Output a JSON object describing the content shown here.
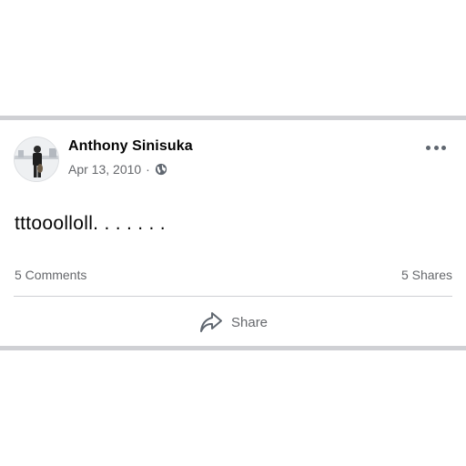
{
  "post": {
    "author": "Anthony Sinisuka",
    "date": "Apr 13, 2010",
    "separator": "·",
    "privacy_icon": "globe-icon",
    "body": "tttooolloll. . . . . . .",
    "comments": "5 Comments",
    "shares": "5 Shares",
    "share_label": "Share"
  },
  "icons": {
    "more": "more-options-icon",
    "share": "share-arrow-icon"
  },
  "colors": {
    "text_primary": "#050505",
    "text_secondary": "#65676b",
    "border": "#cfd0d4"
  }
}
